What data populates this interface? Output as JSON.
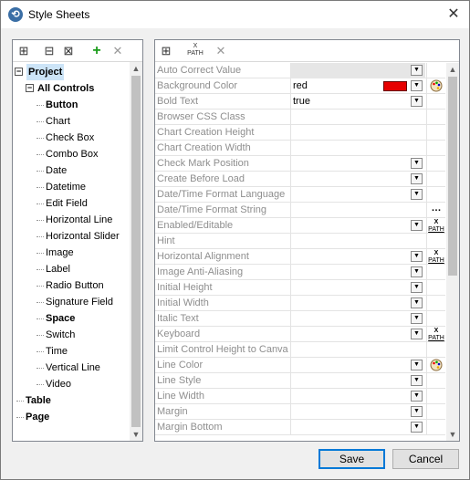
{
  "window": {
    "title": "Style Sheets"
  },
  "tree": {
    "items": [
      {
        "label": "Project",
        "level": 0,
        "bold": true,
        "toggle": "minus",
        "selected": true
      },
      {
        "label": "All Controls",
        "level": 1,
        "bold": true,
        "toggle": "minus"
      },
      {
        "label": "Button",
        "level": 2,
        "bold": true
      },
      {
        "label": "Chart",
        "level": 2
      },
      {
        "label": "Check Box",
        "level": 2
      },
      {
        "label": "Combo Box",
        "level": 2
      },
      {
        "label": "Date",
        "level": 2
      },
      {
        "label": "Datetime",
        "level": 2
      },
      {
        "label": "Edit Field",
        "level": 2
      },
      {
        "label": "Horizontal Line",
        "level": 2
      },
      {
        "label": "Horizontal Slider",
        "level": 2
      },
      {
        "label": "Image",
        "level": 2
      },
      {
        "label": "Label",
        "level": 2
      },
      {
        "label": "Radio Button",
        "level": 2
      },
      {
        "label": "Signature Field",
        "level": 2
      },
      {
        "label": "Space",
        "level": 2,
        "bold": true
      },
      {
        "label": "Switch",
        "level": 2
      },
      {
        "label": "Time",
        "level": 2
      },
      {
        "label": "Vertical Line",
        "level": 2
      },
      {
        "label": "Video",
        "level": 2
      },
      {
        "label": "Table",
        "level": 1,
        "bold": true
      },
      {
        "label": "Page",
        "level": 1,
        "bold": true
      }
    ]
  },
  "properties": [
    {
      "name": "Auto Correct Value",
      "value": "",
      "dropdown": true,
      "gray": true
    },
    {
      "name": "Background Color",
      "value": "red",
      "dropdown": true,
      "swatch": true,
      "aux": "palette"
    },
    {
      "name": "Bold Text",
      "value": "true",
      "dropdown": true
    },
    {
      "name": "Browser CSS Class",
      "value": ""
    },
    {
      "name": "Chart Creation Height",
      "value": ""
    },
    {
      "name": "Chart Creation Width",
      "value": ""
    },
    {
      "name": "Check Mark Position",
      "value": "",
      "dropdown": true
    },
    {
      "name": "Create Before Load",
      "value": "",
      "dropdown": true
    },
    {
      "name": "Date/Time Format Language",
      "value": "",
      "dropdown": true
    },
    {
      "name": "Date/Time Format String",
      "value": "",
      "aux": "ellipsis"
    },
    {
      "name": "Enabled/Editable",
      "value": "",
      "dropdown": true,
      "aux": "xpath"
    },
    {
      "name": "Hint",
      "value": ""
    },
    {
      "name": "Horizontal Alignment",
      "value": "",
      "dropdown": true,
      "aux": "xpath"
    },
    {
      "name": "Image Anti-Aliasing",
      "value": "",
      "dropdown": true
    },
    {
      "name": "Initial Height",
      "value": "",
      "dropdown": true
    },
    {
      "name": "Initial Width",
      "value": "",
      "dropdown": true
    },
    {
      "name": "Italic Text",
      "value": "",
      "dropdown": true
    },
    {
      "name": "Keyboard",
      "value": "",
      "dropdown": true,
      "aux": "xpath"
    },
    {
      "name": "Limit Control Height to Canvas",
      "value": ""
    },
    {
      "name": "Line Color",
      "value": "",
      "dropdown": true,
      "aux": "palette"
    },
    {
      "name": "Line Style",
      "value": "",
      "dropdown": true
    },
    {
      "name": "Line Width",
      "value": "",
      "dropdown": true
    },
    {
      "name": "Margin",
      "value": "",
      "dropdown": true
    },
    {
      "name": "Margin Bottom",
      "value": "",
      "dropdown": true
    }
  ],
  "buttons": {
    "save": "Save",
    "cancel": "Cancel"
  },
  "icons": {
    "app": "stylesheet-icon",
    "xpath_label_top": "X",
    "xpath_label_bottom": "PATH"
  },
  "colors": {
    "swatch_red": "#e60000",
    "selection": "#cce4f7",
    "default_border": "#0078d7"
  }
}
